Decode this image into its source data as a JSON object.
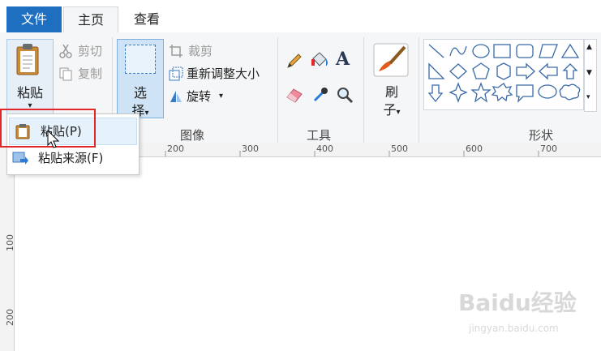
{
  "tabs": [
    {
      "label": "文件"
    },
    {
      "label": "主页"
    },
    {
      "label": "查看"
    }
  ],
  "clipboard": {
    "paste_label": "粘贴",
    "cut_label": "剪切",
    "copy_label": "复制"
  },
  "image": {
    "select_label_1": "选",
    "select_label_2": "择",
    "crop_label": "裁剪",
    "resize_label": "重新调整大小",
    "rotate_label": "旋转",
    "group_label": "图像"
  },
  "tools": {
    "group_label": "工具"
  },
  "brushes": {
    "label_1": "刷",
    "label_2": "子"
  },
  "shapes": {
    "group_label": "形状"
  },
  "paste_menu": {
    "items": [
      {
        "label": "粘贴(P)"
      },
      {
        "label": "粘贴来源(F)"
      }
    ]
  },
  "ruler": {
    "h_ticks": [
      "200",
      "300",
      "400",
      "500",
      "600",
      "700"
    ],
    "v_ticks": [
      "100",
      "200"
    ]
  },
  "colors": {
    "file_tab": "#1f6fc1",
    "highlight": "#e2272a",
    "accent": "#3a7ac0"
  },
  "watermark": {
    "main": "Baidu经验",
    "sub": "jingyan.baidu.com"
  }
}
